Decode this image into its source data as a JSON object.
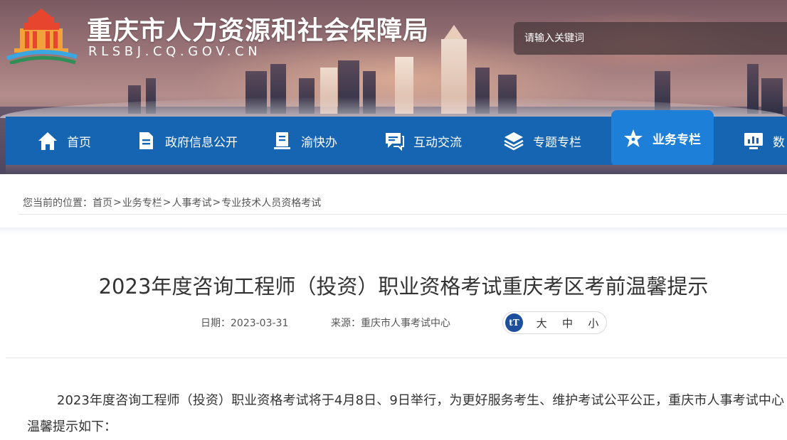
{
  "header": {
    "site_title": "重庆市人力资源和社会保障局",
    "site_domain": "RLSBJ.CQ.GOV.CN",
    "search_placeholder": "请输入关键词"
  },
  "nav": {
    "items": [
      {
        "label": "首页",
        "icon": "home-icon"
      },
      {
        "label": "政府信息公开",
        "icon": "document-icon"
      },
      {
        "label": "渝快办",
        "icon": "book-icon"
      },
      {
        "label": "互动交流",
        "icon": "chat-icon"
      },
      {
        "label": "专题专栏",
        "icon": "layers-icon"
      },
      {
        "label": "业务专栏",
        "icon": "star-icon",
        "active": true
      },
      {
        "label": "数",
        "icon": "monitor-chart-icon"
      }
    ],
    "active_color": "#1e7fd9",
    "bar_color": "#1565b3"
  },
  "breadcrumb": {
    "prefix": "您当前的位置：",
    "items": [
      "首页",
      "业务专栏",
      "人事考试",
      "专业技术人员资格考试"
    ],
    "separator": ">"
  },
  "article": {
    "title": "2023年度咨询工程师（投资）职业资格考试重庆考区考前温馨提示",
    "date_label": "日期：",
    "date": "2023-03-31",
    "source_label": "来源：",
    "source": "重庆市人事考试中心",
    "font_size": {
      "badge": "tT",
      "large": "大",
      "medium": "中",
      "small": "小"
    },
    "paragraph": "2023年度咨询工程师（投资）职业资格考试将于4月8日、9日举行，为更好服务考生、维护考试公平公正，重庆市人事考试中心温馨提示如下："
  }
}
